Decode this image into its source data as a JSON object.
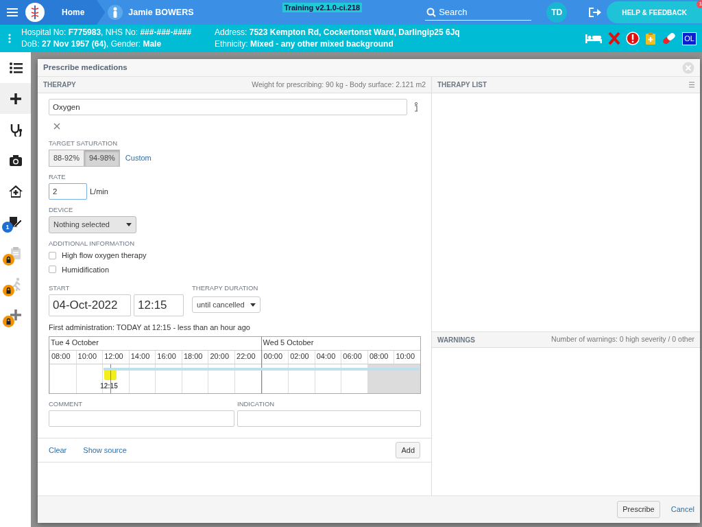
{
  "top_bar": {
    "home": "Home",
    "patient_name": "Jamie BOWERS",
    "version": "Training v2.1.0-ci.218",
    "search": {
      "placeholder": "Search"
    },
    "avatar": "TD",
    "help": "HELP & FEEDBACK",
    "help_badge": "1"
  },
  "patient_bar": {
    "lines": [
      {
        "left": "Hospital No: **F775983**, NHS No: **###-###-####**",
        "right": "Address: **7523 Kempton Rd, Cockertonst Ward, Darlingip25 6Jq**"
      },
      {
        "left": "DoB: **27 Nov 1957 (64)**, Gender: **Male**",
        "right": "Ethnicity: **Mixed - any other mixed background**"
      }
    ],
    "status_icons": [
      {
        "kind": "bed"
      },
      {
        "kind": "cross"
      },
      {
        "kind": "alert"
      },
      {
        "kind": "clipboard"
      },
      {
        "kind": "pill"
      },
      {
        "kind": "text",
        "label": "OL"
      }
    ]
  },
  "sidebar": {
    "items": [
      {
        "kind": "list",
        "selected": false,
        "locked": false
      },
      {
        "kind": "plus",
        "selected": true,
        "locked": false
      },
      {
        "kind": "stethoscope",
        "selected": false,
        "locked": false
      },
      {
        "kind": "camera",
        "selected": false,
        "locked": false
      },
      {
        "kind": "home",
        "selected": false,
        "locked": false
      },
      {
        "kind": "edit",
        "selected": false,
        "locked": false,
        "badge": "1"
      },
      {
        "kind": "clipboard",
        "selected": false,
        "locked": true
      },
      {
        "kind": "walker",
        "selected": false,
        "locked": true
      },
      {
        "kind": "plus",
        "selected": false,
        "locked": true
      }
    ]
  },
  "modal": {
    "title": "Prescribe medications",
    "therapy": {
      "header": "THERAPY",
      "weight": "Weight for prescribing: 90 kg - Body surface: 2.121 m2",
      "medication": "Oxygen",
      "target_saturation": {
        "label": "TARGET SATURATION",
        "options": [
          {
            "label": "88-92%",
            "selected": false
          },
          {
            "label": "94-98%",
            "selected": true
          }
        ],
        "custom": "Custom"
      },
      "rate": {
        "label": "RATE",
        "value": "2",
        "unit": "L/min"
      },
      "device": {
        "label": "DEVICE",
        "value": "Nothing selected"
      },
      "additional": {
        "label": "ADDITIONAL INFORMATION",
        "options": [
          {
            "label": "High flow oxygen therapy",
            "checked": false
          },
          {
            "label": "Humidification",
            "checked": false
          }
        ]
      },
      "start": {
        "label": "START",
        "date": "04-Oct-2022",
        "time": "12:15"
      },
      "duration": {
        "label": "THERAPY DURATION",
        "value": "until cancelled"
      },
      "first_administration": "First administration: TODAY at 12:15 - less than an hour ago",
      "timeline": {
        "days": [
          {
            "label": "Tue 4 October",
            "hours": [
              {
                "label": "08:00",
                "shaded": false
              },
              {
                "label": "10:00",
                "shaded": false
              },
              {
                "label": "12:00",
                "shaded": false,
                "marker": "12:15"
              },
              {
                "label": "14:00",
                "shaded": false
              },
              {
                "label": "16:00",
                "shaded": false
              },
              {
                "label": "18:00",
                "shaded": false
              },
              {
                "label": "20:00",
                "shaded": false
              },
              {
                "label": "22:00",
                "shaded": false
              }
            ]
          },
          {
            "label": "Wed 5 October",
            "hours": [
              {
                "label": "00:00",
                "shaded": false
              },
              {
                "label": "02:00",
                "shaded": false
              },
              {
                "label": "04:00",
                "shaded": false
              },
              {
                "label": "06:00",
                "shaded": false
              },
              {
                "label": "08:00",
                "shaded": true
              },
              {
                "label": "10:00",
                "shaded": true
              }
            ]
          }
        ]
      },
      "comment": {
        "label": "COMMENT"
      },
      "indication": {
        "label": "INDICATION"
      },
      "links": [
        "Clear",
        "Show source"
      ],
      "add": "Add"
    },
    "therapy_list": {
      "header": "THERAPY LIST"
    },
    "warnings": {
      "header": "WARNINGS",
      "count": "Number of warnings: 0 high severity / 0 other"
    },
    "prescribe": "Prescribe",
    "cancel": "Cancel"
  }
}
